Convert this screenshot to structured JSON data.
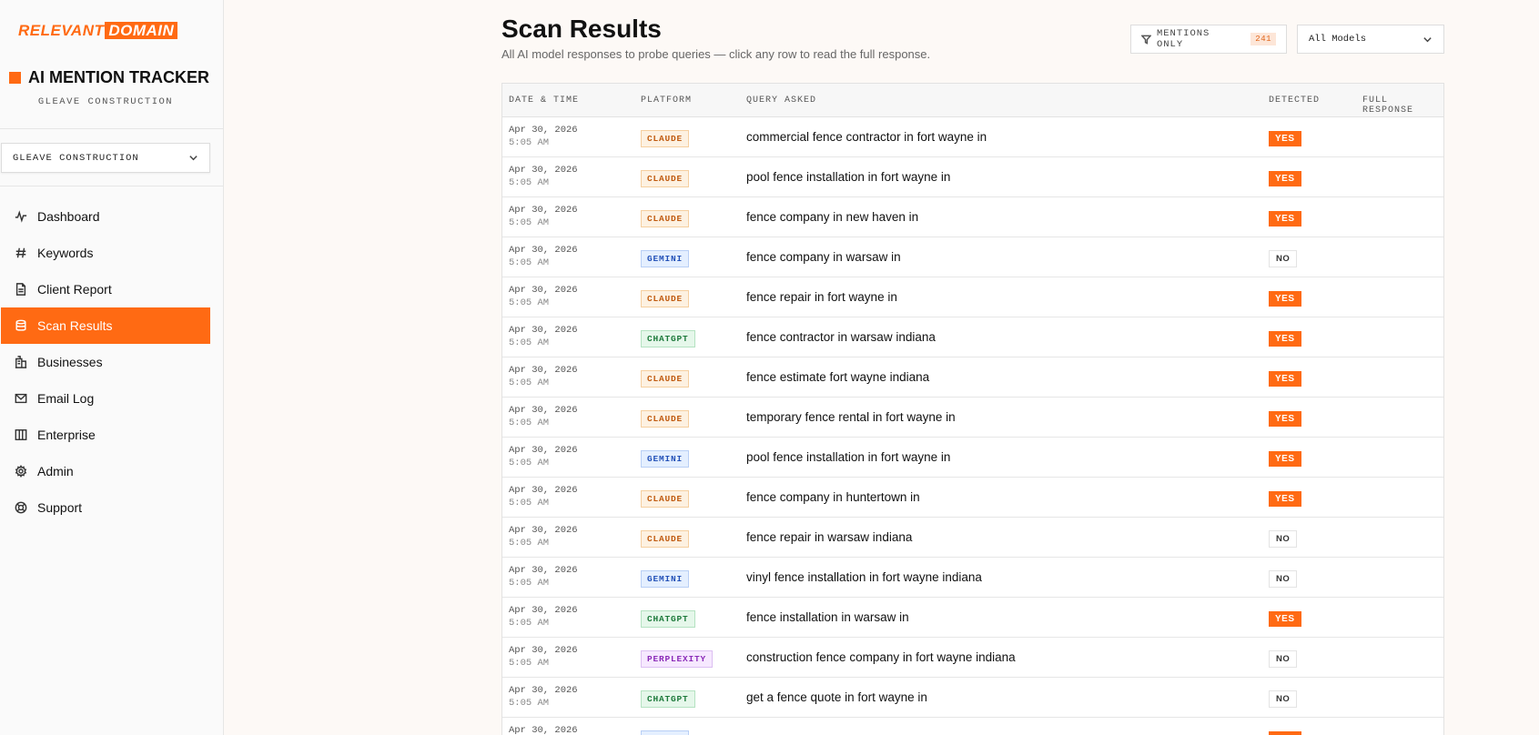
{
  "brand": {
    "part1": "RELEVANT",
    "part2": "DOMAIN"
  },
  "app": {
    "title": "AI MENTION TRACKER",
    "subtitle": "GLEAVE CONSTRUCTION",
    "accent_color": "#ff6a13"
  },
  "business_selector": {
    "value": "GLEAVE CONSTRUCTION"
  },
  "nav": [
    {
      "label": "Dashboard",
      "icon": "activity-icon",
      "active": false
    },
    {
      "label": "Keywords",
      "icon": "hash-icon",
      "active": false
    },
    {
      "label": "Client Report",
      "icon": "file-text-icon",
      "active": false
    },
    {
      "label": "Scan Results",
      "icon": "database-icon",
      "active": true
    },
    {
      "label": "Businesses",
      "icon": "building-icon",
      "active": false
    },
    {
      "label": "Email Log",
      "icon": "mail-icon",
      "active": false
    },
    {
      "label": "Enterprise",
      "icon": "columns-icon",
      "active": false
    },
    {
      "label": "Admin",
      "icon": "gear-icon",
      "active": false
    },
    {
      "label": "Support",
      "icon": "life-buoy-icon",
      "active": false
    }
  ],
  "page": {
    "title": "Scan Results",
    "subtitle": "All AI model responses to probe queries — click any row to read the full response."
  },
  "filters": {
    "mentions_label": "MENTIONS ONLY",
    "mentions_count": "241",
    "model_select": "All Models"
  },
  "table": {
    "headers": {
      "date": "DATE & TIME",
      "platform": "PLATFORM",
      "query": "QUERY ASKED",
      "detected": "DETECTED",
      "full_response": "FULL RESPONSE"
    },
    "rows": [
      {
        "date": "Apr 30, 2026",
        "time": "5:05 AM",
        "platform": "CLAUDE",
        "query": "commercial fence contractor in fort wayne in",
        "detected": "YES"
      },
      {
        "date": "Apr 30, 2026",
        "time": "5:05 AM",
        "platform": "CLAUDE",
        "query": "pool fence installation in fort wayne in",
        "detected": "YES"
      },
      {
        "date": "Apr 30, 2026",
        "time": "5:05 AM",
        "platform": "CLAUDE",
        "query": "fence company in new haven in",
        "detected": "YES"
      },
      {
        "date": "Apr 30, 2026",
        "time": "5:05 AM",
        "platform": "GEMINI",
        "query": "fence company in warsaw in",
        "detected": "NO"
      },
      {
        "date": "Apr 30, 2026",
        "time": "5:05 AM",
        "platform": "CLAUDE",
        "query": "fence repair in fort wayne in",
        "detected": "YES"
      },
      {
        "date": "Apr 30, 2026",
        "time": "5:05 AM",
        "platform": "CHATGPT",
        "query": "fence contractor in warsaw indiana",
        "detected": "YES"
      },
      {
        "date": "Apr 30, 2026",
        "time": "5:05 AM",
        "platform": "CLAUDE",
        "query": "fence estimate fort wayne indiana",
        "detected": "YES"
      },
      {
        "date": "Apr 30, 2026",
        "time": "5:05 AM",
        "platform": "CLAUDE",
        "query": "temporary fence rental in fort wayne in",
        "detected": "YES"
      },
      {
        "date": "Apr 30, 2026",
        "time": "5:05 AM",
        "platform": "GEMINI",
        "query": "pool fence installation in fort wayne in",
        "detected": "YES"
      },
      {
        "date": "Apr 30, 2026",
        "time": "5:05 AM",
        "platform": "CLAUDE",
        "query": "fence company in huntertown in",
        "detected": "YES"
      },
      {
        "date": "Apr 30, 2026",
        "time": "5:05 AM",
        "platform": "CLAUDE",
        "query": "fence repair in warsaw indiana",
        "detected": "NO"
      },
      {
        "date": "Apr 30, 2026",
        "time": "5:05 AM",
        "platform": "GEMINI",
        "query": "vinyl fence installation in fort wayne indiana",
        "detected": "NO"
      },
      {
        "date": "Apr 30, 2026",
        "time": "5:05 AM",
        "platform": "CHATGPT",
        "query": "fence installation in warsaw in",
        "detected": "YES"
      },
      {
        "date": "Apr 30, 2026",
        "time": "5:05 AM",
        "platform": "PERPLEXITY",
        "query": "construction fence company in fort wayne indiana",
        "detected": "NO"
      },
      {
        "date": "Apr 30, 2026",
        "time": "5:05 AM",
        "platform": "CHATGPT",
        "query": "get a fence quote in fort wayne in",
        "detected": "NO"
      },
      {
        "date": "Apr 30, 2026",
        "time": "",
        "platform": "GEMINI",
        "query": "",
        "detected": "YES"
      }
    ]
  }
}
